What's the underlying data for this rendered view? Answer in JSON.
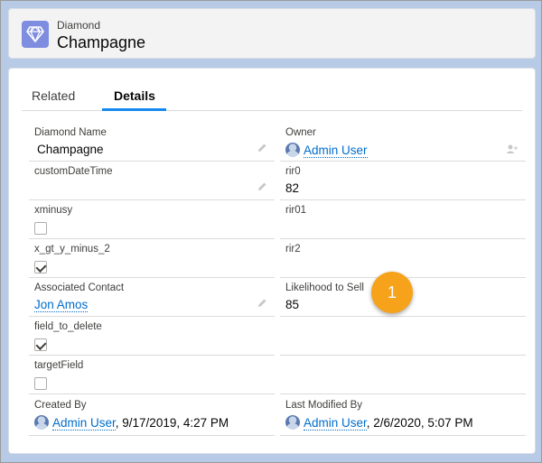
{
  "header": {
    "object_type": "Diamond",
    "record_name": "Champagne"
  },
  "tabs": [
    {
      "label": "Related"
    },
    {
      "label": "Details"
    }
  ],
  "left_fields": [
    {
      "label": "Diamond Name",
      "value": "Champagne"
    },
    {
      "label": "customDateTime",
      "value": ""
    },
    {
      "label": "xminusy",
      "checked": false
    },
    {
      "label": "x_gt_y_minus_2",
      "checked": true
    },
    {
      "label": "Associated Contact",
      "value": "Jon Amos"
    },
    {
      "label": "field_to_delete",
      "checked": true
    },
    {
      "label": "targetField",
      "checked": false
    },
    {
      "label": "Created By",
      "user": "Admin User",
      "date": ", 9/17/2019, 4:27 PM"
    }
  ],
  "right_fields": [
    {
      "label": "Owner",
      "user": "Admin User"
    },
    {
      "label": "rir0",
      "value": "82"
    },
    {
      "label": "rir01",
      "value": ""
    },
    {
      "label": "rir2",
      "value": ""
    },
    {
      "label": "Likelihood to Sell",
      "value": "85"
    },
    {
      "label": "",
      "value": ""
    },
    {
      "label": "",
      "value": ""
    },
    {
      "label": "Last Modified By",
      "user": "Admin User",
      "date": ", 2/6/2020, 5:07 PM"
    }
  ],
  "callout": {
    "number": "1",
    "color": "#f7a21b"
  },
  "colors": {
    "accent": "#1589ee",
    "link": "#006dcc",
    "object_icon": "#7f8de1"
  },
  "icons": {
    "object": "diamond-icon",
    "edit": "pencil-icon",
    "user": "user-avatar-icon",
    "change_owner": "change-owner-icon"
  }
}
